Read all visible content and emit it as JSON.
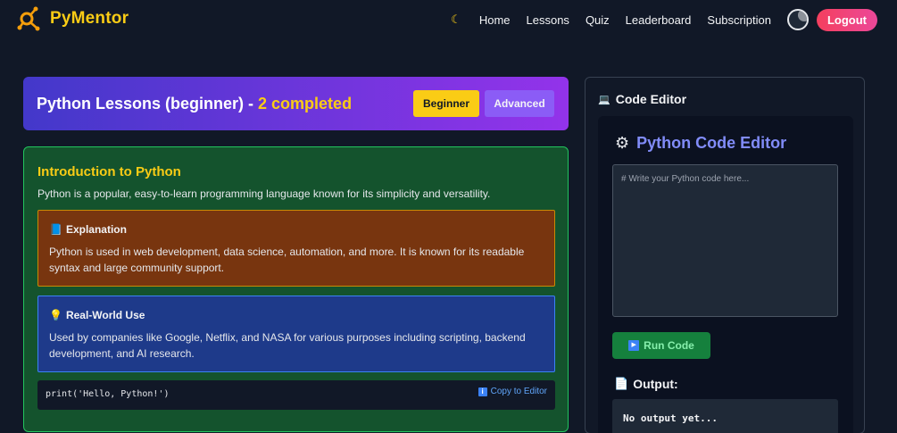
{
  "nav": {
    "brand": "PyMentor",
    "theme_toggle_icon": "moon-icon",
    "links": [
      "Home",
      "Lessons",
      "Quiz",
      "Leaderboard",
      "Subscription"
    ],
    "logout": "Logout"
  },
  "lessons_header": {
    "title_prefix": "Python Lessons (beginner) - ",
    "completed": "2 completed",
    "level_beginner": "Beginner",
    "level_advanced": "Advanced"
  },
  "lesson": {
    "title": "Introduction to Python",
    "description": "Python is a popular, easy-to-learn programming language known for its simplicity and versatility.",
    "explanation": {
      "icon": "book-icon",
      "heading": "Explanation",
      "text": "Python is used in web development, data science, automation, and more. It is known for its readable syntax and large community support."
    },
    "real_world": {
      "icon": "lightbulb-icon",
      "heading": "Real-World Use",
      "text": "Used by companies like Google, Netflix, and NASA for various purposes including scripting, backend development, and AI research."
    },
    "code": "print('Hello, Python!')",
    "copy_label": "Copy to Editor"
  },
  "editor": {
    "panel_title": "Code Editor",
    "panel_icon": "laptop-icon",
    "title": "Python Code Editor",
    "title_icon": "gear-icon",
    "placeholder": "# Write your Python code here...",
    "value": "",
    "run_label": "Run Code",
    "output_label": "Output:",
    "output_icon": "page-icon",
    "output_text": "No output yet..."
  },
  "colors": {
    "accent": "#facc15",
    "header_gradient_start": "#4338ca",
    "header_gradient_end": "#9333ea",
    "lesson_bg": "#14532d",
    "logout": "#f43f5e"
  }
}
